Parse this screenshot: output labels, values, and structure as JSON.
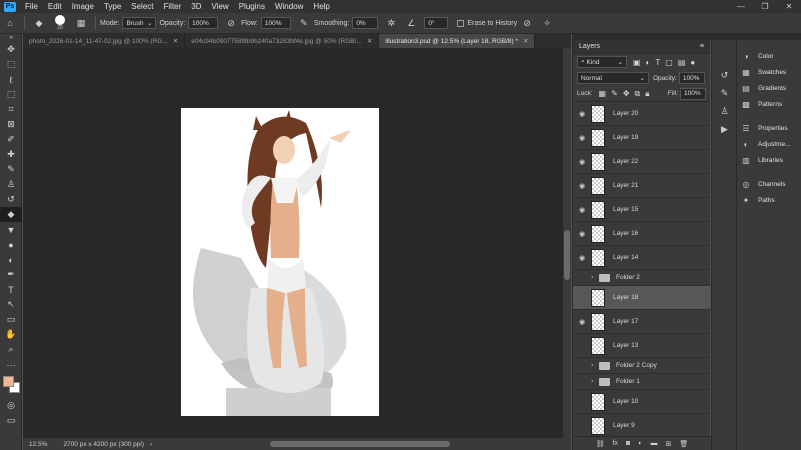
{
  "menu": [
    "File",
    "Edit",
    "Image",
    "Type",
    "Select",
    "Filter",
    "3D",
    "View",
    "Plugins",
    "Window",
    "Help"
  ],
  "window_controls": [
    "—",
    "❐",
    "✕"
  ],
  "options": {
    "brush_size": "20",
    "mode_label": "Mode:",
    "mode_value": "Brush",
    "opacity_label": "Opacity:",
    "opacity_value": "100%",
    "flow_label": "Flow:",
    "flow_value": "100%",
    "smoothing_label": "Smoothing:",
    "smoothing_value": "0%",
    "angle_value": "0°",
    "erase_history": "Erase to History"
  },
  "tabs": [
    {
      "label": "photo_2026-01-14_11-47-02.jpg @ 100% (RG...",
      "active": false
    },
    {
      "label": "e04c94b0907758f8b9b240a73283bf4e.jpg @ 50% (RGB/...",
      "active": false
    },
    {
      "label": "illustration3.psd @ 12.5% (Layer 18, RGB/8) *",
      "active": true
    }
  ],
  "status": {
    "zoom": "12.5%",
    "dimensions": "2700 px x 4200 px (300 ppi)"
  },
  "layers_panel": {
    "title": "Layers",
    "kind_label": "Kind",
    "blend_mode": "Normal",
    "opacity_label": "Opacity:",
    "opacity_value": "100%",
    "lock_label": "Lock:",
    "fill_label": "Fill:",
    "fill_value": "100%",
    "layers": [
      {
        "name": "Layer 20",
        "type": "layer",
        "visible": true
      },
      {
        "name": "Layer 19",
        "type": "layer",
        "visible": true
      },
      {
        "name": "Layer 22",
        "type": "layer",
        "visible": true
      },
      {
        "name": "Layer 21",
        "type": "layer",
        "visible": true
      },
      {
        "name": "Layer 15",
        "type": "layer",
        "visible": true
      },
      {
        "name": "Layer 16",
        "type": "layer",
        "visible": true
      },
      {
        "name": "Layer 14",
        "type": "layer",
        "visible": true
      },
      {
        "name": "Folder 2",
        "type": "folder",
        "visible": false
      },
      {
        "name": "Layer 18",
        "type": "layer",
        "visible": false,
        "selected": true
      },
      {
        "name": "Layer 17",
        "type": "layer",
        "visible": true
      },
      {
        "name": "Layer 13",
        "type": "layer",
        "visible": false
      },
      {
        "name": "Folder 2 Copy",
        "type": "folder",
        "visible": false
      },
      {
        "name": "Folder 1",
        "type": "folder",
        "visible": false
      },
      {
        "name": "Layer 10",
        "type": "layer",
        "visible": false
      },
      {
        "name": "Layer 9",
        "type": "layer",
        "visible": false
      }
    ]
  },
  "side_panels": [
    {
      "label": "Color",
      "icon": "color-icon"
    },
    {
      "label": "Swatches",
      "icon": "swatches-icon"
    },
    {
      "label": "Gradients",
      "icon": "gradients-icon"
    },
    {
      "label": "Patterns",
      "icon": "patterns-icon"
    },
    {
      "label": "Properties",
      "icon": "properties-icon"
    },
    {
      "label": "Adjustme...",
      "icon": "adjustments-icon"
    },
    {
      "label": "Libraries",
      "icon": "libraries-icon"
    },
    {
      "label": "Channels",
      "icon": "channels-icon"
    },
    {
      "label": "Paths",
      "icon": "paths-icon"
    }
  ],
  "colors": {
    "foreground": "#f0b896",
    "background": "#ffffff",
    "accent": "#31a8ff"
  }
}
